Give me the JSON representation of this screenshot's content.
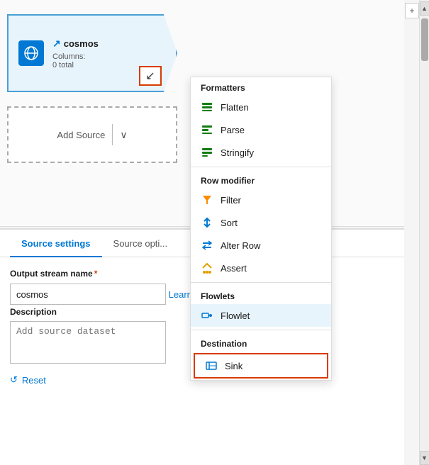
{
  "canvas": {
    "cosmos_node": {
      "title": "cosmos",
      "title_icon": "↗",
      "columns_label": "Columns:",
      "columns_value": "0 total"
    },
    "node_btn_label": "↙",
    "add_source": {
      "label": "Add Source",
      "chevron": "∨"
    }
  },
  "toolbar": {
    "plus_label": "+",
    "scroll_up": "▲",
    "scroll_down": "▼"
  },
  "bottom_panel": {
    "tabs": [
      {
        "label": "Source settings",
        "active": true
      },
      {
        "label": "Source opti...",
        "active": false
      }
    ],
    "output_stream": {
      "label": "Output stream name",
      "required": "*",
      "value": "cosmos"
    },
    "learn_more": {
      "label": "Learn more",
      "icon": "⧉"
    },
    "description": {
      "label": "Description",
      "placeholder": "Add source dataset"
    },
    "reset": {
      "icon": "↺",
      "label": "Reset"
    }
  },
  "dropdown_menu": {
    "sections": [
      {
        "header": "Formatters",
        "items": [
          {
            "id": "flatten",
            "label": "Flatten",
            "icon": "flatten"
          },
          {
            "id": "parse",
            "label": "Parse",
            "icon": "parse"
          },
          {
            "id": "stringify",
            "label": "Stringify",
            "icon": "stringify"
          }
        ]
      },
      {
        "header": "Row modifier",
        "items": [
          {
            "id": "filter",
            "label": "Filter",
            "icon": "filter"
          },
          {
            "id": "sort",
            "label": "Sort",
            "icon": "sort"
          },
          {
            "id": "alterrow",
            "label": "Alter Row",
            "icon": "alterrow"
          },
          {
            "id": "assert",
            "label": "Assert",
            "icon": "assert"
          }
        ]
      },
      {
        "header": "Flowlets",
        "items": [
          {
            "id": "flowlet",
            "label": "Flowlet",
            "icon": "flowlet",
            "highlighted": true
          }
        ]
      },
      {
        "header": "Destination",
        "items": [
          {
            "id": "sink",
            "label": "Sink",
            "icon": "sink",
            "bordered": true
          }
        ]
      }
    ]
  }
}
